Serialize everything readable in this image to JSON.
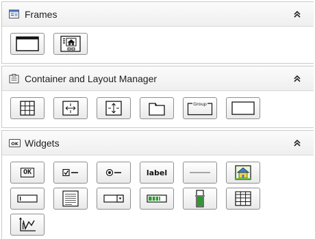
{
  "sections": [
    {
      "title": "Frames",
      "icon": "frame-section-icon",
      "collapse_icon": "double-chevron-up-icon",
      "items": [
        "window-frame-icon",
        "frame-with-image-icon"
      ]
    },
    {
      "title": "Container and Layout Manager",
      "icon": "container-section-icon",
      "collapse_icon": "double-chevron-up-icon",
      "items": [
        "grid-layout-icon",
        "horizontal-layout-icon",
        "vertical-layout-icon",
        "tab-panel-icon",
        "group-box-icon",
        "panel-icon"
      ]
    },
    {
      "title": "Widgets",
      "icon": "widgets-section-icon",
      "collapse_icon": "double-chevron-up-icon",
      "items": [
        "button-icon",
        "checkbox-icon",
        "radio-button-icon",
        "label-icon",
        "separator-icon",
        "image-icon",
        "text-field-icon",
        "text-area-icon",
        "combo-box-icon",
        "progress-bar-icon",
        "slider-gauge-icon",
        "table-icon",
        "chart-icon"
      ]
    }
  ],
  "widget_text": {
    "ok": "OK",
    "label": "label",
    "group": "Group"
  },
  "colors": {
    "border": "#8d8d8d",
    "green": "#2e9a2e",
    "house_blue": "#3a7fd6",
    "house_yellow": "#f3d34a"
  }
}
